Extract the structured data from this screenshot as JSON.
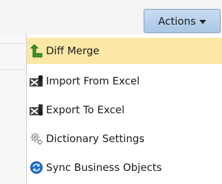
{
  "toolbar": {
    "actions_label": "Actions",
    "actions_caret_icon": "chevron-down-icon"
  },
  "menu": {
    "items": [
      {
        "label": "Diff Merge",
        "icon": "diff-merge-arrow-icon",
        "highlighted": true
      },
      {
        "label": "Import From Excel",
        "icon": "import-excel-icon",
        "highlighted": false
      },
      {
        "label": "Export To Excel",
        "icon": "export-excel-icon",
        "highlighted": false
      },
      {
        "label": "Dictionary Settings",
        "icon": "gear-icon",
        "highlighted": false
      },
      {
        "label": "Sync Business Objects",
        "icon": "sync-icon",
        "highlighted": false
      }
    ]
  },
  "colors": {
    "highlight": "#fbe8a4",
    "button_top": "#c9ddf2",
    "button_bottom": "#a9c6e5",
    "diff_merge_green": "#3a9a2a",
    "sync_blue": "#1f6fd1"
  }
}
